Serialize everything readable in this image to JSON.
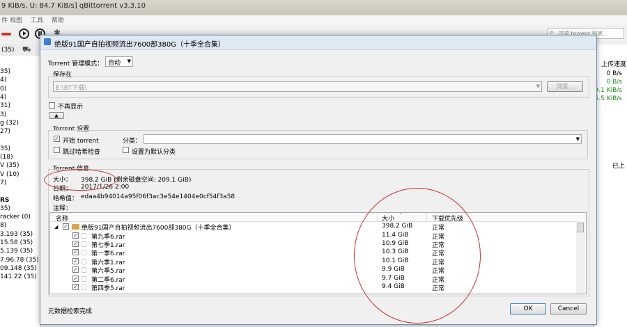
{
  "background_window": {
    "title": "9 KiB/s, U: 84.7 KiB/s] qBittorrent v3.3.10",
    "menu": [
      "件",
      "视图",
      "工具",
      "帮助"
    ],
    "search_placeholder": "过滤 torrent 列表...",
    "sidebar_tab": "(35)",
    "sidebar_lines": [
      {
        "text": "35)",
        "bold": false
      },
      {
        "text": "4)",
        "bold": false
      },
      {
        "text": "0)",
        "bold": false
      },
      {
        "text": "4)",
        "bold": false
      },
      {
        "text": "31)",
        "bold": false
      },
      {
        "text": "3)",
        "bold": false
      },
      {
        "text": "g (32)",
        "bold": false
      },
      {
        "text": "27)",
        "bold": false
      },
      {
        "text": "",
        "bold": false
      },
      {
        "text": "35)",
        "bold": false
      },
      {
        "text": "(18)",
        "bold": false
      },
      {
        "text": "V (35)",
        "bold": false
      },
      {
        "text": "V (10)",
        "bold": false
      },
      {
        "text": "7)",
        "bold": false
      },
      {
        "text": "",
        "bold": false
      },
      {
        "text": "RS",
        "bold": true
      },
      {
        "text": "35)",
        "bold": false
      },
      {
        "text": "racker (0)",
        "bold": false
      },
      {
        "text": "8)",
        "bold": false
      },
      {
        "text": "3.193 (35)",
        "bold": false
      },
      {
        "text": "15.58 (35)",
        "bold": false
      },
      {
        "text": "5.139 (35)",
        "bold": false
      },
      {
        "text": "7.96.78 (35)",
        "bold": false
      },
      {
        "text": "09.148 (35)",
        "bold": false
      },
      {
        "text": "141.22 (35)",
        "bold": false
      }
    ],
    "right_header": "上传速度",
    "right_speeds": [
      {
        "text": "0 B/s",
        "color": "#000000"
      },
      {
        "text": "0 B/s",
        "color": "#1f8a1f"
      },
      {
        "text": "9.1 KiB/s",
        "color": "#1f8a1f"
      },
      {
        "text": "5.5 KiB/s",
        "color": "#1f8a1f"
      }
    ],
    "right_lower_label": "已上"
  },
  "dialog": {
    "title": "绝版91国产自拍视频流出7600部380G（十季全合集）",
    "torrent_mode_label": "Torrent 管理模式：",
    "torrent_mode_value": "自动",
    "save_in_label": "保存在",
    "save_path": "E:\\BT下载\\",
    "browse_label": "浏览...",
    "dont_show_label": "不再显示",
    "settings_group_label": "Torrent 设置",
    "start_torrent_label": "开始 torrent",
    "start_torrent_checked": true,
    "category_label": "分类：",
    "category_value": "",
    "skip_hash_label": "跳过哈希检查",
    "skip_hash_checked": false,
    "set_default_category_label": "设置为默认分类",
    "set_default_checked": false,
    "info_group_label": "Torrent 信息",
    "size_label": "大小：",
    "size_value": "398.2 GiB (剩余磁盘空间: 209.1 GiB)",
    "date_label": "日期：",
    "date_value": "2017/1/26 2:00",
    "hash_label": "哈希值：",
    "hash_value": "edaa4b94014a95f06f3ac3e54e1404e0cf54f3a58",
    "comment_label": "注释：",
    "columns": {
      "name": "名称",
      "size": "大小",
      "priority": "下载优先级"
    },
    "root": {
      "name": "绝版91国产自拍视频流出7600部380G（十季全合集）",
      "size": "398.2 GiB",
      "priority": "正常"
    },
    "files": [
      {
        "name": "第九季6.rar",
        "size": "11.4 GiB",
        "priority": "正常"
      },
      {
        "name": "第七季1.rar",
        "size": "10.9 GiB",
        "priority": "正常"
      },
      {
        "name": "第一季6.rar",
        "size": "10.3 GiB",
        "priority": "正常"
      },
      {
        "name": "第六季1.rar",
        "size": "10.1 GiB",
        "priority": "正常"
      },
      {
        "name": "第六季5.rar",
        "size": "9.9 GiB",
        "priority": "正常"
      },
      {
        "name": "第二季6.rar",
        "size": "9.7 GiB",
        "priority": "正常"
      },
      {
        "name": "第四季5.rar",
        "size": "9.4 GiB",
        "priority": "正常"
      }
    ],
    "status_text": "元数据检索完成",
    "ok_label": "OK",
    "cancel_label": "Cancel"
  },
  "annotation_color": "#c8302e"
}
